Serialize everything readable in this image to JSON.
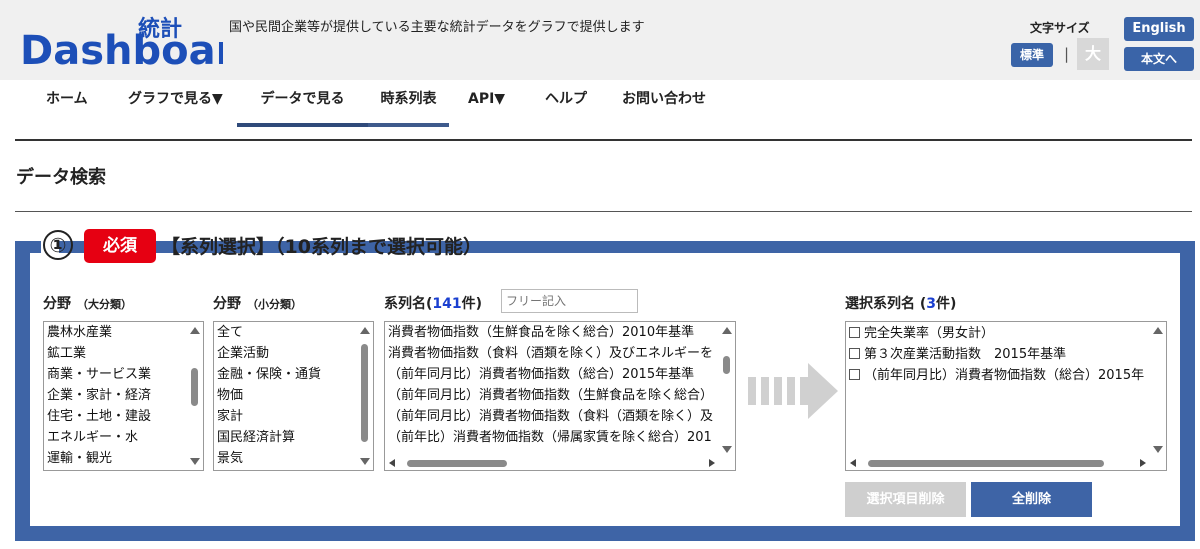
{
  "header": {
    "logo_text": "Dashboard",
    "logo_kanji": "統計",
    "tagline": "国や民間企業等が提供している主要な統計データをグラフで提供します",
    "font_size_label": "文字サイズ",
    "font_standard": "標準",
    "separator": "|",
    "font_large": "大",
    "english_label": "English",
    "main_text_label": "本文へ"
  },
  "nav": {
    "home": "ホーム",
    "graph": "グラフで見る▼",
    "data": "データで見る",
    "timeseries": "時系列表",
    "api": "API▼",
    "help": "ヘルプ",
    "contact": "お問い合わせ"
  },
  "page": {
    "title": "データ検索"
  },
  "section": {
    "number": "①",
    "required_badge": "必須",
    "title": "【系列選択】（10系列まで選択可能）"
  },
  "filters": {
    "major_label": "分野",
    "major_sub": "（大分類）",
    "major_items": [
      "農林水産業",
      "鉱工業",
      "商業・サービス業",
      "企業・家計・経済",
      "住宅・土地・建設",
      "エネルギー・水",
      "運輸・観光"
    ],
    "minor_label": "分野",
    "minor_sub": "（小分類）",
    "minor_items": [
      "全て",
      "企業活動",
      "金融・保険・通貨",
      "物価",
      "家計",
      "国民経済計算",
      "景気"
    ]
  },
  "series": {
    "label_prefix": "系列名(",
    "count": "141",
    "label_suffix": "件)",
    "search_placeholder": "フリー記入",
    "items": [
      "消費者物価指数（生鮮食品を除く総合）2010年基準",
      "消費者物価指数（食料（酒類を除く）及びエネルギーを",
      "（前年同月比）消費者物価指数（総合）2015年基準",
      "（前年同月比）消費者物価指数（生鮮食品を除く総合）",
      "（前年同月比）消費者物価指数（食料（酒類を除く）及",
      "（前年比）消費者物価指数（帰属家賃を除く総合）201"
    ]
  },
  "selected": {
    "label_prefix": "選択系列名 (",
    "count": "3",
    "label_suffix": "件)",
    "items": [
      "完全失業率（男女計）",
      "第３次産業活動指数　2015年基準",
      "（前年同月比）消費者物価指数（総合）2015年"
    ]
  },
  "actions": {
    "delete_selected": "選択項目削除",
    "delete_all": "全削除"
  },
  "colors": {
    "brand_blue": "#3e64a6",
    "required_red": "#e60012",
    "count_blue": "#1a3fd0"
  }
}
